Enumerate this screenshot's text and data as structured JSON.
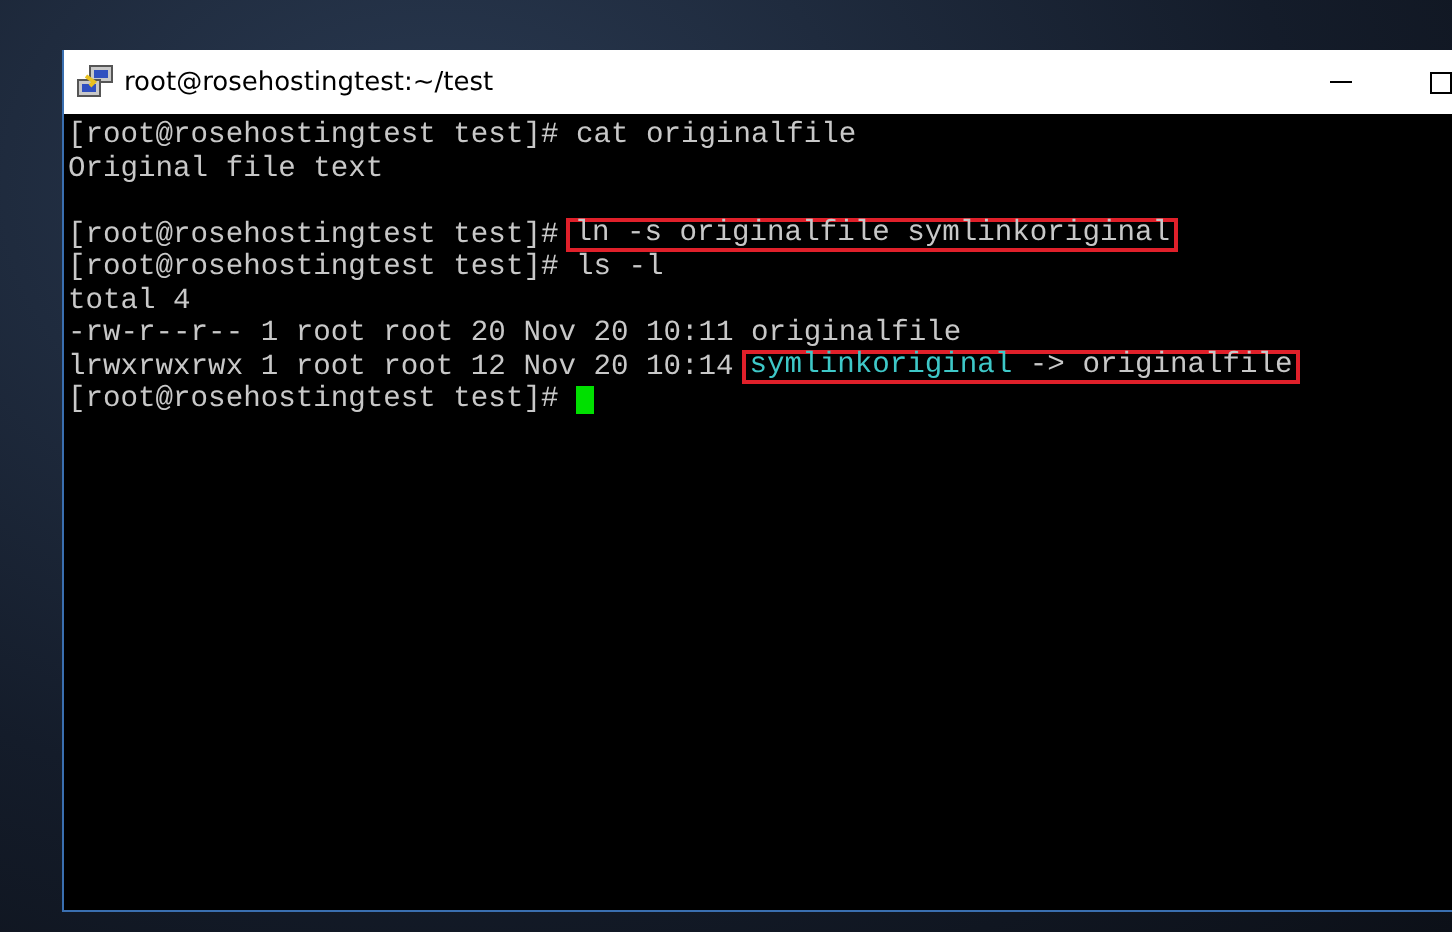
{
  "window": {
    "title": "root@rosehostingtest:~/test"
  },
  "terminal": {
    "lines": [
      {
        "kind": "output",
        "segments": [
          {
            "text": "[root@rosehostingtest test]# cat originalfile",
            "kind": "text",
            "boxed": false
          }
        ]
      },
      {
        "kind": "output",
        "segments": [
          {
            "text": "Original file text",
            "kind": "text",
            "boxed": false
          }
        ]
      },
      {
        "kind": "blank"
      },
      {
        "kind": "output",
        "segments": [
          {
            "text": "[root@rosehostingtest test]#",
            "kind": "text",
            "boxed": false
          },
          {
            "text": "ln -s originalfile symlinkoriginal",
            "kind": "text",
            "boxed": true
          }
        ]
      },
      {
        "kind": "output",
        "segments": [
          {
            "text": "[root@rosehostingtest test]# ls -l",
            "kind": "text",
            "boxed": false
          }
        ]
      },
      {
        "kind": "output",
        "segments": [
          {
            "text": "total 4",
            "kind": "text",
            "boxed": false
          }
        ]
      },
      {
        "kind": "output",
        "segments": [
          {
            "text": "-rw-r--r-- 1 root root 20 Nov 20 10:11 originalfile",
            "kind": "text",
            "boxed": false
          }
        ]
      },
      {
        "kind": "output",
        "segments": [
          {
            "text": "lrwxrwxrwx 1 root root 12 Nov 20 10:14",
            "kind": "text",
            "boxed": false
          },
          {
            "text": "symlinkoriginal",
            "kind": "symlink",
            "boxed": true
          },
          {
            "text": " -> originalfile",
            "kind": "text",
            "boxed": true
          }
        ]
      },
      {
        "kind": "prompt",
        "cursor": true,
        "segments": [
          {
            "text": "[root@rosehostingtest test]#",
            "kind": "text",
            "boxed": false
          }
        ]
      }
    ]
  }
}
